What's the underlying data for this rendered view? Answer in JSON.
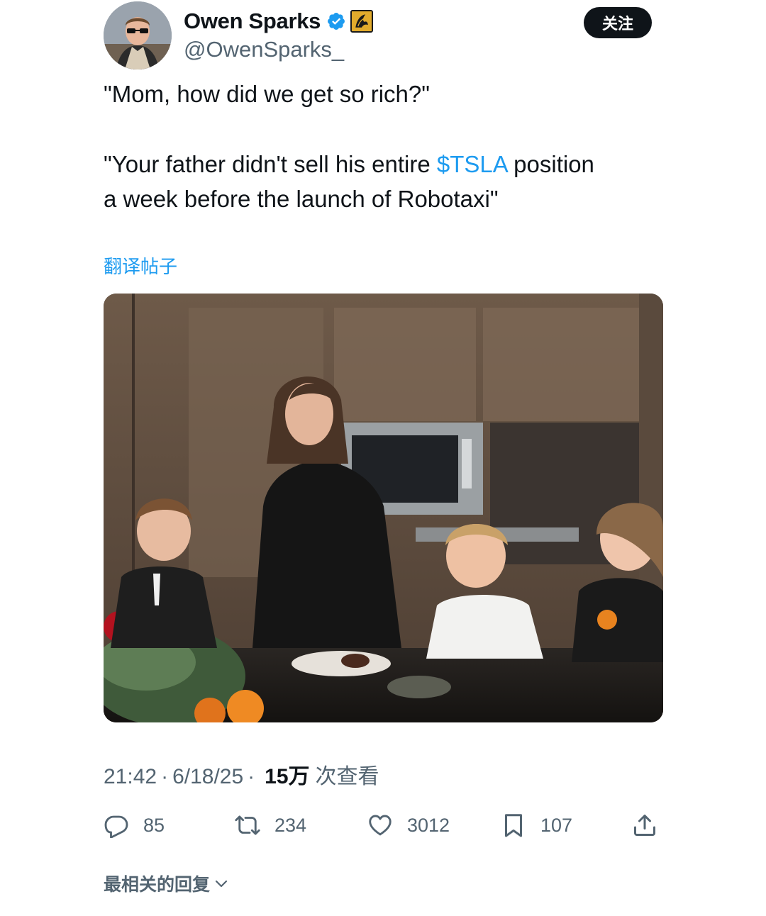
{
  "author": {
    "display_name": "Owen Sparks",
    "handle": "@OwenSparks_",
    "verified_icon": "verified-badge-icon",
    "affiliate_icon": "affiliate-badge-icon"
  },
  "follow_button": {
    "label": "关注"
  },
  "tweet": {
    "line1": "\"Mom, how did we get so rich?\"",
    "line2_before": "\"Your father didn't sell his entire ",
    "cashtag": "$TSLA",
    "line2_after": " position",
    "line3": "a week before the launch of Robotaxi\""
  },
  "translate_link": "翻译帖子",
  "media": {
    "alt_kind": "photo"
  },
  "meta": {
    "time": "21:42",
    "separator": "·",
    "date": "6/18/25",
    "views_count": "15万",
    "views_label": "次查看"
  },
  "actions": {
    "reply": "85",
    "repost": "234",
    "like": "3012",
    "bookmark": "107"
  },
  "replies_sort": {
    "label": "最相关的回复"
  },
  "colors": {
    "accent": "#1d9bf0",
    "text": "#0f1419",
    "secondary": "#536471",
    "button_bg": "#0f1419"
  }
}
